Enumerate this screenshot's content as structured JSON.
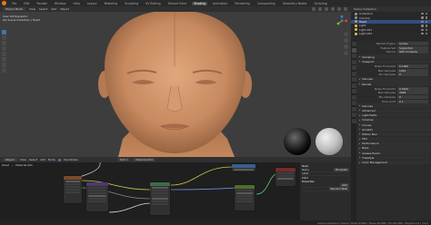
{
  "topbar": {
    "menus": [
      "File",
      "Edit",
      "Render",
      "Window",
      "Help"
    ],
    "workspaces": [
      "Layout",
      "Modeling",
      "Sculpting",
      "UV Editing",
      "Texture Paint",
      "Shading",
      "Animation",
      "Rendering",
      "Compositing",
      "Geometry Nodes",
      "Scripting"
    ],
    "active_workspace": "Shading"
  },
  "viewport": {
    "mode": "Object Mode",
    "menus": [
      "View",
      "Select",
      "Add",
      "Object"
    ],
    "overlay_line1": "User Orthographic",
    "overlay_line2": "(0) Scene Collection | Head"
  },
  "node_editor": {
    "mode": "Object",
    "menus": [
      "View",
      "Select",
      "Add",
      "Node"
    ],
    "use_nodes_label": "Use Nodes",
    "slot": "Slot 1",
    "material": "Material.001",
    "breadcrumb": [
      "Head",
      "Material.001"
    ]
  },
  "node_panel": {
    "rows": [
      {
        "type": "section",
        "label": "Node"
      },
      {
        "label": "Name",
        "value": "Principled"
      },
      {
        "label": "Label",
        "value": ""
      },
      {
        "type": "section",
        "label": "Color"
      },
      {
        "type": "section",
        "label": "Properties"
      },
      {
        "label": "",
        "value": "GGX"
      },
      {
        "label": "",
        "value": "Random Walk"
      }
    ]
  },
  "outliner": {
    "title": "Scene Collection",
    "items": [
      {
        "name": "Collection",
        "color": "#9a9a9a",
        "selected": false
      },
      {
        "name": "Camera",
        "color": "#6a9fd4",
        "selected": false
      },
      {
        "name": "Head",
        "color": "#e08d3c",
        "selected": true
      },
      {
        "name": "Light",
        "color": "#e0c44a",
        "selected": false
      },
      {
        "name": "Light.001",
        "color": "#e0c44a",
        "selected": false
      },
      {
        "name": "Light.002",
        "color": "#e0c44a",
        "selected": false
      }
    ]
  },
  "properties": {
    "rows": [
      {
        "type": "r",
        "label": "Render Engine",
        "value": "Cycles"
      },
      {
        "type": "r",
        "label": "Feature Set",
        "value": "Supported"
      },
      {
        "type": "r",
        "label": "Device",
        "value": "GPU Compute"
      },
      {
        "type": "sh",
        "label": "Sampling"
      },
      {
        "type": "sh",
        "label": "Viewport"
      },
      {
        "type": "r",
        "label": "Noise Threshold",
        "value": "0.1000"
      },
      {
        "type": "r",
        "label": "Max Samples",
        "value": "1024"
      },
      {
        "type": "r",
        "label": "Min Samples",
        "value": "0"
      },
      {
        "type": "sh",
        "label": "Denoise"
      },
      {
        "type": "sh",
        "label": "Render"
      },
      {
        "type": "r",
        "label": "Noise Threshold",
        "value": "0.0100"
      },
      {
        "type": "r",
        "label": "Max Samples",
        "value": "4096"
      },
      {
        "type": "r",
        "label": "Min Samples",
        "value": "0"
      },
      {
        "type": "r",
        "label": "Time Limit",
        "value": "0 s"
      },
      {
        "type": "sh",
        "label": "Denoise"
      },
      {
        "type": "sh",
        "label": "Advanced"
      },
      {
        "type": "sh",
        "label": "Light Paths"
      },
      {
        "type": "sh",
        "label": "Volumes"
      },
      {
        "type": "sh",
        "label": "Curves"
      },
      {
        "type": "sh",
        "label": "Simplify"
      },
      {
        "type": "sh",
        "label": "Motion Blur"
      },
      {
        "type": "sh",
        "label": "Film"
      },
      {
        "type": "sh",
        "label": "Performance"
      },
      {
        "type": "sh",
        "label": "Bake"
      },
      {
        "type": "sh",
        "label": "Grease Pencil"
      },
      {
        "type": "sh",
        "label": "Freestyle"
      },
      {
        "type": "sh",
        "label": "Color Management"
      }
    ]
  },
  "status": {
    "text": "Scene Collection | Head | Verts:10,004 | Faces:10,000 | Tris:20,000 | Objects:1/4 | 3.2.0"
  }
}
